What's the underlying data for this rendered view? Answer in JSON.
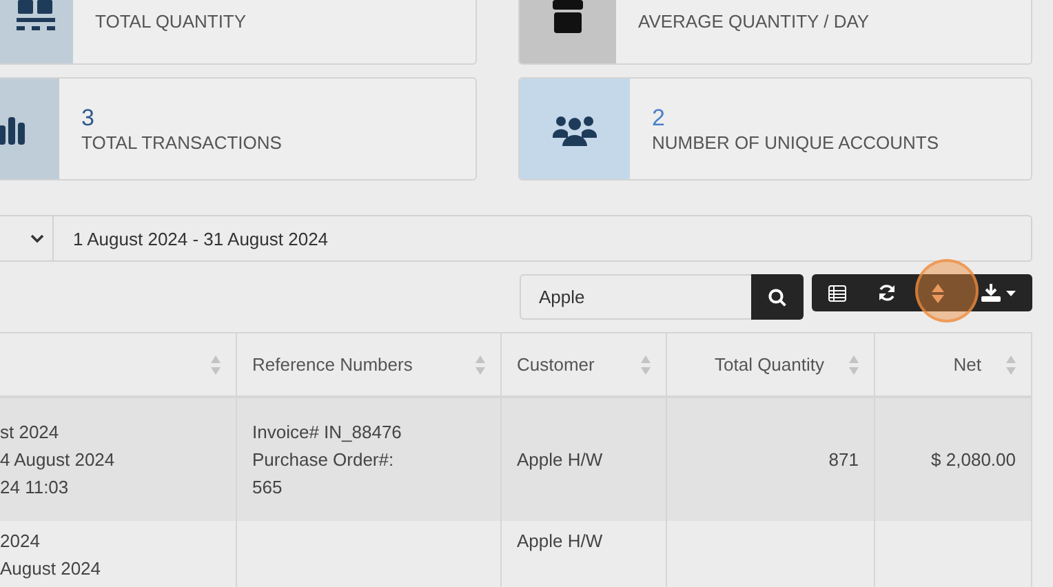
{
  "stats": [
    {
      "label": "TOTAL QUANTITY",
      "kind": "pallet"
    },
    {
      "label": "AVERAGE QUANTITY / DAY",
      "kind": "box"
    },
    {
      "label": "TOTAL TRANSACTIONS",
      "kind": "bars",
      "value": "3"
    },
    {
      "label": "NUMBER OF UNIQUE ACCOUNTS",
      "kind": "users",
      "value": "2"
    }
  ],
  "date_range": {
    "value": "1 August 2024 - 31 August 2024"
  },
  "search": {
    "value": "Apple"
  },
  "toolbar": [
    {
      "kind": "columns",
      "highlighted": false
    },
    {
      "kind": "refresh",
      "highlighted": false
    },
    {
      "kind": "sort",
      "highlighted": true
    },
    {
      "kind": "download",
      "highlighted": false
    }
  ],
  "table": {
    "columns": [
      "",
      "Reference Numbers",
      "Customer",
      "Total Quantity",
      "Net"
    ],
    "rows": [
      {
        "cells": [
          [
            "st 2024",
            "4 August 2024",
            "24 11:03"
          ],
          [
            "Invoice# IN_88476",
            "Purchase Order#:",
            "565"
          ],
          [
            "Apple H/W"
          ],
          [
            "871"
          ],
          [
            "$ 2,080.00"
          ]
        ]
      },
      {
        "cells": [
          [
            "2024",
            "August 2024"
          ],
          [],
          [
            "Apple H/W"
          ],
          [],
          []
        ]
      }
    ]
  }
}
